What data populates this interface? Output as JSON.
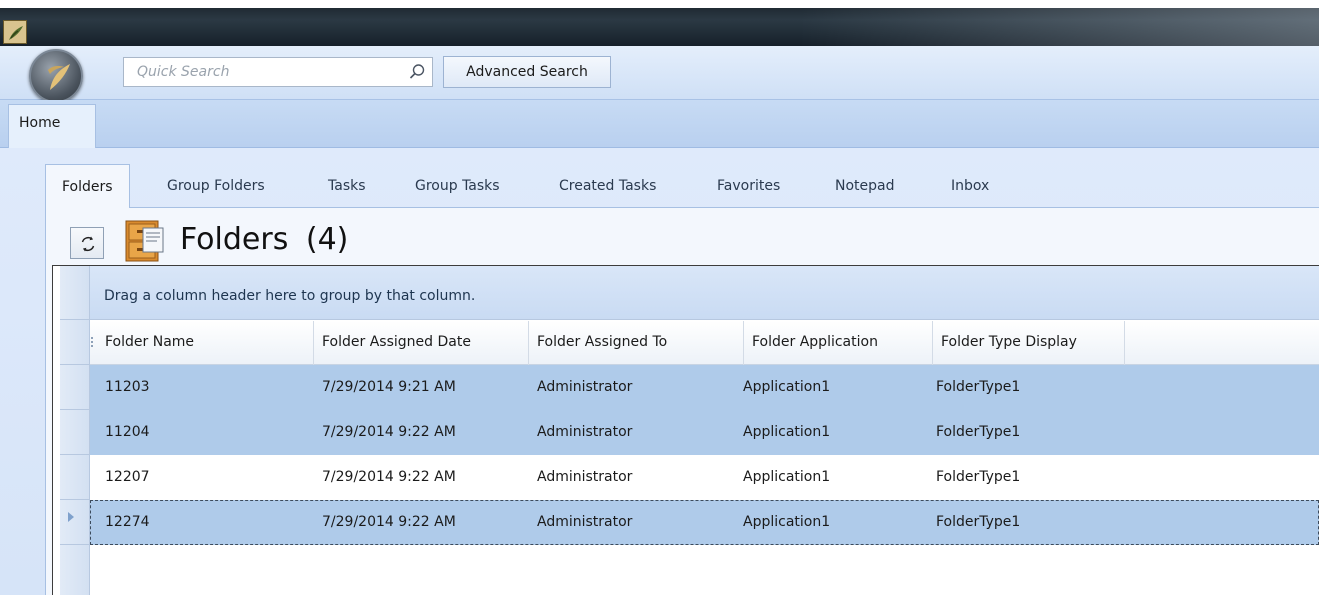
{
  "window": {
    "app_icon": "leaf-logo-icon"
  },
  "toolbar": {
    "orb_icon": "leaf-orb-icon",
    "search": {
      "placeholder": "Quick Search",
      "value": "",
      "icon": "search-icon"
    },
    "advanced_search_label": "Advanced Search"
  },
  "ribbon": {
    "tabs": [
      {
        "label": "Home",
        "active": true
      }
    ]
  },
  "view_tabs": [
    {
      "label": "Folders",
      "active": true
    },
    {
      "label": "Group Folders",
      "active": false
    },
    {
      "label": "Tasks",
      "active": false
    },
    {
      "label": "Group Tasks",
      "active": false
    },
    {
      "label": "Created Tasks",
      "active": false
    },
    {
      "label": "Favorites",
      "active": false
    },
    {
      "label": "Notepad",
      "active": false
    },
    {
      "label": "Inbox",
      "active": false
    }
  ],
  "page": {
    "refresh_icon": "refresh-icon",
    "cabinet_icon": "file-cabinet-icon",
    "title": "Folders",
    "count": "(4)"
  },
  "grid": {
    "group_hint": "Drag a column header here to group by that column.",
    "columns": [
      "Folder Name",
      "Folder Assigned Date",
      "Folder Assigned To",
      "Folder Application",
      "Folder Type Display"
    ],
    "rows": [
      {
        "cells": [
          "11203",
          "7/29/2014 9:21 AM",
          "Administrator",
          "Application1",
          "FolderType1"
        ],
        "selected": true,
        "focused": false
      },
      {
        "cells": [
          "11204",
          "7/29/2014 9:22 AM",
          "Administrator",
          "Application1",
          "FolderType1"
        ],
        "selected": true,
        "focused": false
      },
      {
        "cells": [
          "12207",
          "7/29/2014 9:22 AM",
          "Administrator",
          "Application1",
          "FolderType1"
        ],
        "selected": false,
        "focused": false
      },
      {
        "cells": [
          "12274",
          "7/29/2014 9:22 AM",
          "Administrator",
          "Application1",
          "FolderType1"
        ],
        "selected": true,
        "focused": true
      }
    ]
  },
  "colors": {
    "selection": "#afcbea",
    "ribbon": "#c7dbf4",
    "accent_border": "#a7c0e3"
  }
}
